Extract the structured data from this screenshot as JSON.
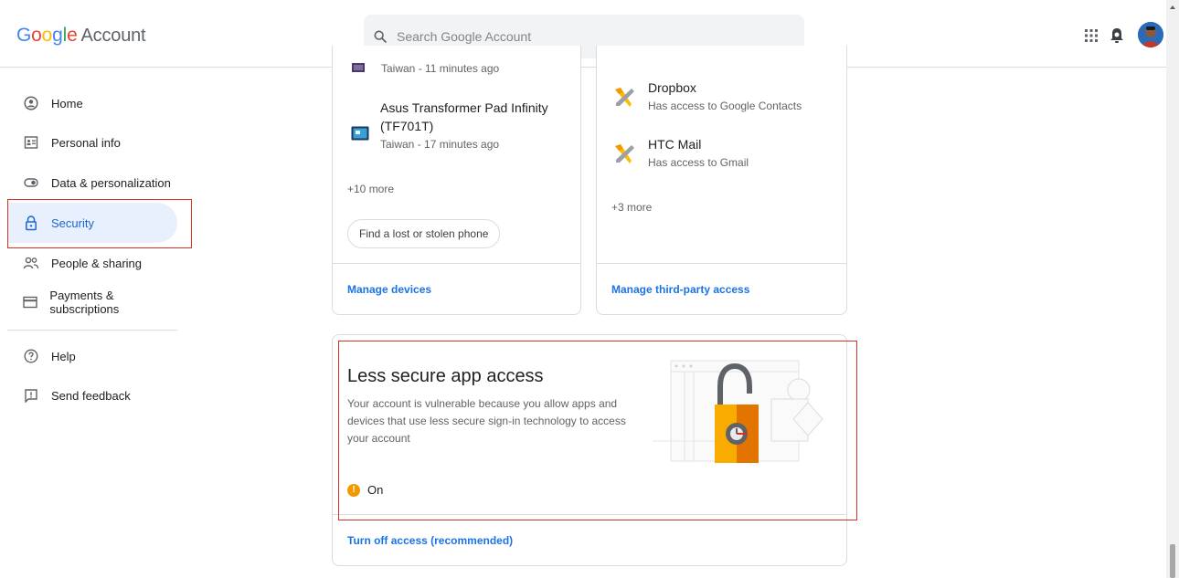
{
  "header": {
    "logo_google": "Google",
    "logo_account": "Account",
    "search_placeholder": "Search Google Account"
  },
  "colors": {
    "accent": "#1a73e8",
    "active_bg": "#e8f0fe",
    "highlight_border": "#d93025",
    "warning": "#f29900"
  },
  "nav": {
    "items": [
      {
        "label": "Home",
        "icon": "person-circle-icon"
      },
      {
        "label": "Personal info",
        "icon": "id-card-icon"
      },
      {
        "label": "Data & personalization",
        "icon": "toggle-icon"
      },
      {
        "label": "Security",
        "icon": "lock-icon",
        "active": true
      },
      {
        "label": "People & sharing",
        "icon": "people-icon"
      },
      {
        "label": "Payments & subscriptions",
        "icon": "credit-card-icon"
      }
    ],
    "help_items": [
      {
        "label": "Help",
        "icon": "help-icon"
      },
      {
        "label": "Send feedback",
        "icon": "feedback-icon"
      }
    ]
  },
  "devices_card": {
    "first_device_sub": "Taiwan - 11 minutes ago",
    "second_device_name_line1": "Asus Transformer Pad Infinity",
    "second_device_name_line2": "(TF701T)",
    "second_device_sub": "Taiwan - 17 minutes ago",
    "more": "+10 more",
    "find_button": "Find a lost or stolen phone",
    "link": "Manage devices"
  },
  "third_party_card": {
    "apps": [
      {
        "name": "Dropbox",
        "access": "Has access to Google Contacts"
      },
      {
        "name": "HTC Mail",
        "access": "Has access to Gmail"
      }
    ],
    "more": "+3 more",
    "link": "Manage third-party access"
  },
  "less_secure": {
    "title": "Less secure app access",
    "description": "Your account is vulnerable because you allow apps and devices that use less secure sign-in technology to access your account",
    "status": "On",
    "link": "Turn off access (recommended)"
  }
}
